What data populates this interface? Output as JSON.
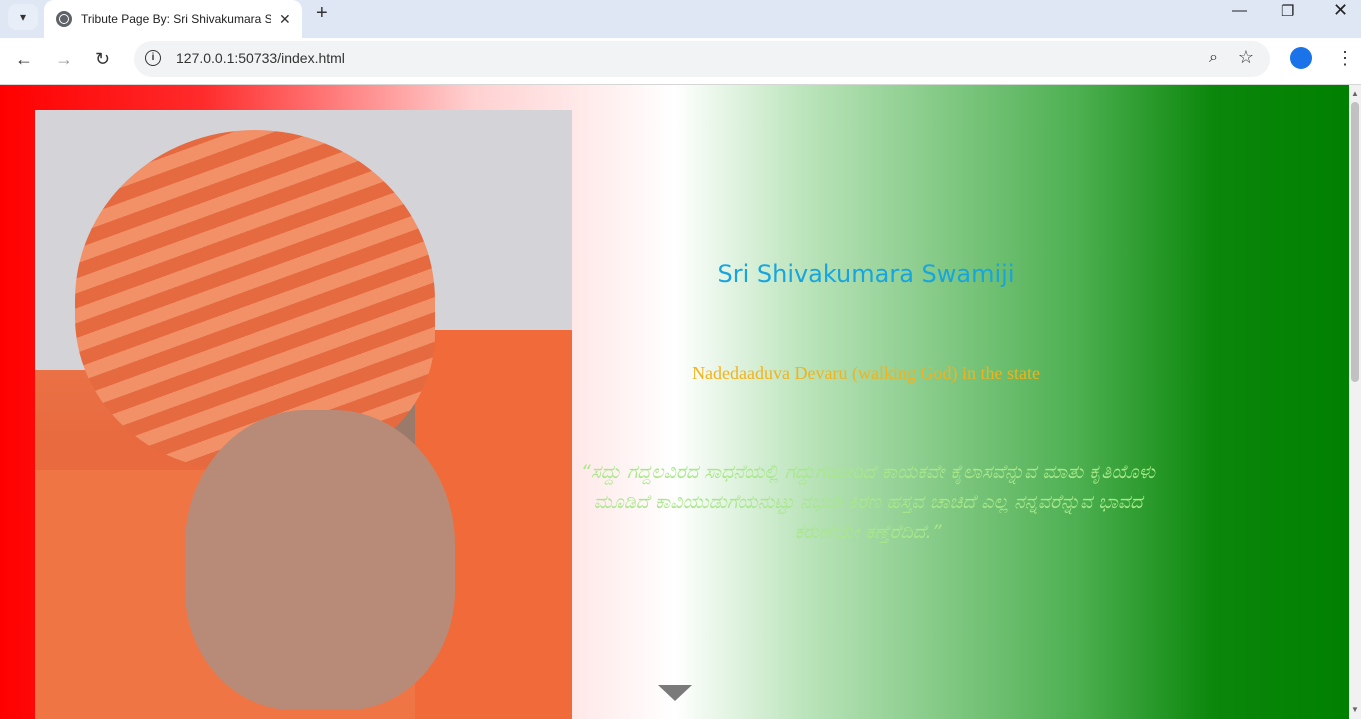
{
  "browser": {
    "tab_title": "Tribute Page By: Sri Shivakumara Swamiji",
    "url": "127.0.0.1:50733/index.html",
    "icons": {
      "tab_menu": "▾",
      "new_tab": "+",
      "minimize": "—",
      "restore": "❐",
      "close_window": "✕",
      "back": "←",
      "forward": "→",
      "reload": "↻",
      "zoom": "⌕",
      "bookmark": "☆",
      "menu": "⋮"
    }
  },
  "page": {
    "title": "Sri Shivakumara Swamiji",
    "subtitle": "Nadedaaduva Devaru (walking God) in the state",
    "quote": "“ಸದ್ದು ಗದ್ದಲವಿರದ ಸಾಧನೆಯಲ್ಲಿ ಗದ್ದುಗೆಯೇರಿದೆ ಕಾಯಕವೇ ಕೈಲಾಸವೆನ್ನುವ ಮಾತು ಕೃತಿಯೊಳು ಮೂಡಿದೆ ಕಾವಿಯುಡುಗೆಯನುಟ್ಟು ನಭದೇ ಕಿರಣ ಹಸ್ತವ ಚಾಚಿದೆ ಎಲ್ಲ ನನ್ನವರೆನ್ನುವ ಭಾವದ ಕರುಣೆಯೇ ಕಣ್ತೆರೆದಿದೆ.”",
    "gradient_colors": [
      "#ff0000",
      "#ffffff",
      "#008000"
    ],
    "heading_color": "#17a5df",
    "subtitle_color": "#f2b21c",
    "quote_color": "#a8e88a"
  }
}
